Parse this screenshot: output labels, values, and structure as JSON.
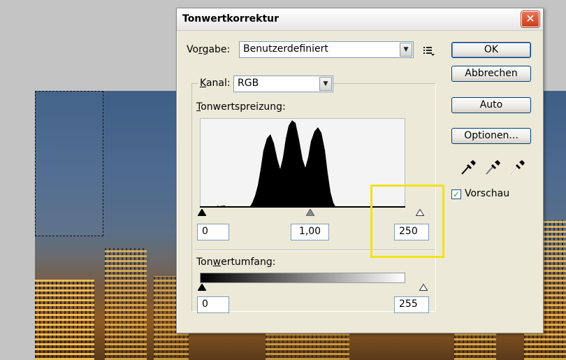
{
  "dialog": {
    "title": "Tonwertkorrektur",
    "close_symbol": "✕"
  },
  "preset": {
    "label_prefix": "Vo",
    "label_underline": "r",
    "label_suffix": "gabe:",
    "value": "Benutzerdefiniert"
  },
  "channel": {
    "label_underline": "K",
    "label_suffix": "anal:",
    "value": "RGB"
  },
  "input_levels": {
    "label_underline": "T",
    "label_suffix": "onwertspreizung:",
    "black": "0",
    "gamma": "1,00",
    "white": "250"
  },
  "output_levels": {
    "label_prefix": "Ton",
    "label_underline": "w",
    "label_suffix": "ertumfang:",
    "black": "0",
    "white": "255"
  },
  "buttons": {
    "ok": "OK",
    "cancel": "Abbrechen",
    "auto": "Auto",
    "options": "Optionen..."
  },
  "preview": {
    "label": "Vorschau",
    "checked": true
  },
  "icons": {
    "close": "close-icon",
    "menu": "list-menu-icon",
    "eyedropper_black": "eyedropper-black-icon",
    "eyedropper_gray": "eyedropper-gray-icon",
    "eyedropper_white": "eyedropper-white-icon"
  },
  "colors": {
    "dialog_bg": "#ece9d8",
    "highlight": "#f2e21a",
    "close_red": "#c6401e",
    "check_green": "#21a121"
  }
}
